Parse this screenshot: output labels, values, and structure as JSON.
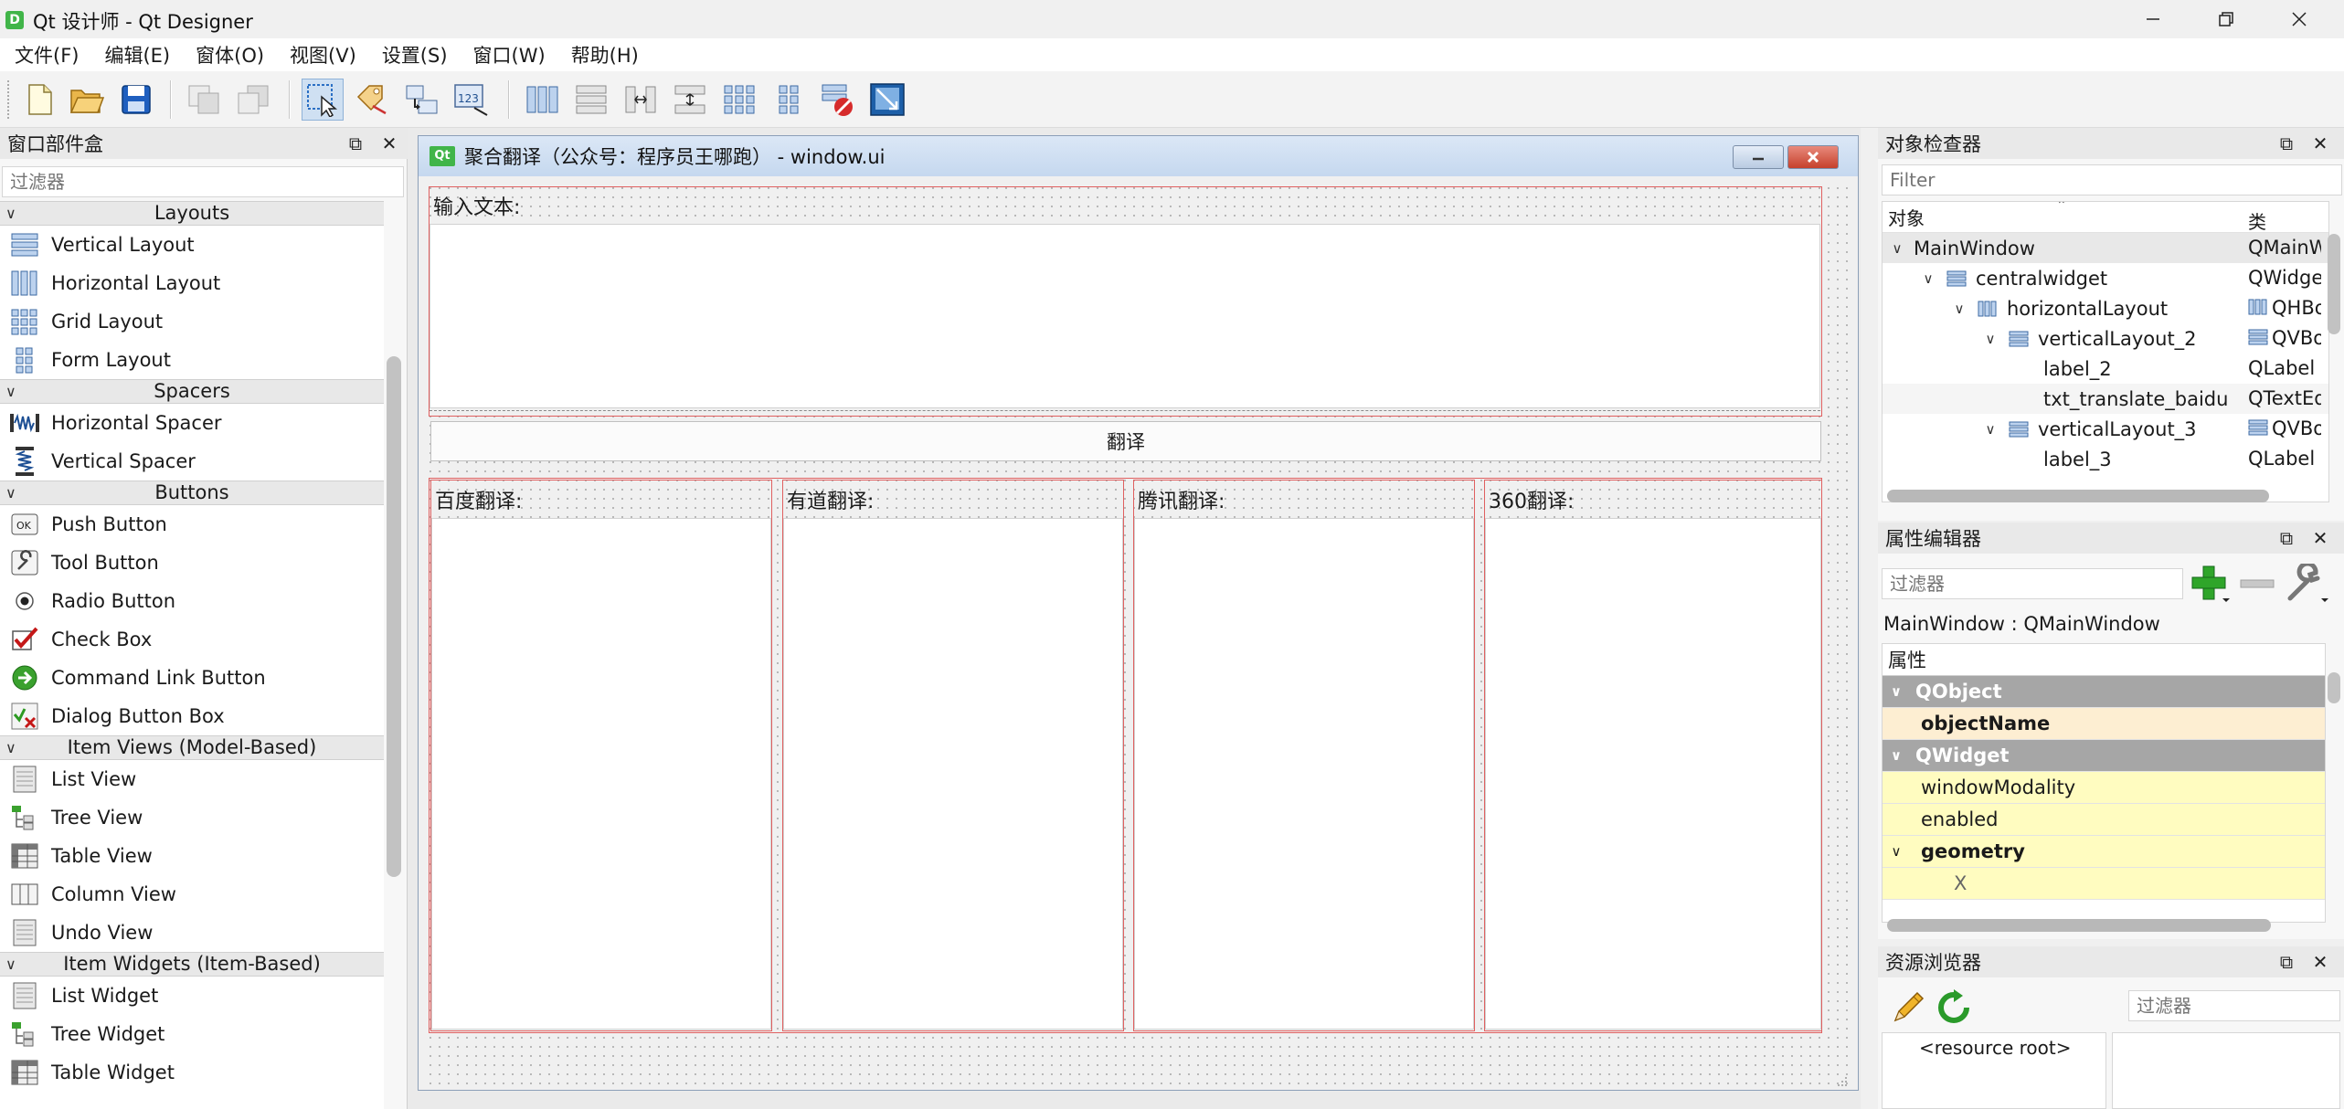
{
  "app": {
    "title": "Qt 设计师 - Qt Designer",
    "icon_letter": "D"
  },
  "menus": [
    "文件(F)",
    "编辑(E)",
    "窗体(O)",
    "视图(V)",
    "设置(S)",
    "窗口(W)",
    "帮助(H)"
  ],
  "toolbar": {
    "buttons": [
      "new-file-icon",
      "open-folder-icon",
      "save-disk-icon",
      "send-to-back-icon",
      "bring-to-front-icon",
      "edit-widgets-icon",
      "edit-signals-slots-icon",
      "edit-buddies-icon",
      "edit-tab-order-icon",
      "layout-horizontal-icon",
      "layout-vertical-icon",
      "layout-h-splitter-icon",
      "layout-v-splitter-icon",
      "layout-grid-icon",
      "layout-form-icon",
      "break-layout-icon",
      "adjust-size-icon"
    ]
  },
  "widget_box": {
    "title": "窗口部件盒",
    "filter_placeholder": "过滤器",
    "categories": [
      {
        "name": "Layouts",
        "items": [
          "Vertical Layout",
          "Horizontal Layout",
          "Grid Layout",
          "Form Layout"
        ]
      },
      {
        "name": "Spacers",
        "items": [
          "Horizontal Spacer",
          "Vertical Spacer"
        ]
      },
      {
        "name": "Buttons",
        "items": [
          "Push Button",
          "Tool Button",
          "Radio Button",
          "Check Box",
          "Command Link Button",
          "Dialog Button Box"
        ]
      },
      {
        "name": "Item Views (Model-Based)",
        "items": [
          "List View",
          "Tree View",
          "Table View",
          "Column View",
          "Undo View"
        ]
      },
      {
        "name": "Item Widgets (Item-Based)",
        "items": [
          "List Widget",
          "Tree Widget",
          "Table Widget"
        ]
      }
    ]
  },
  "form_window": {
    "title": "聚合翻译（公众号：程序员王哪跑） - window.ui",
    "icon_text": "Qt",
    "input_label": "输入文本:",
    "translate_button": "翻译",
    "result_labels": [
      "百度翻译:",
      "有道翻译:",
      "腾讯翻译:",
      "360翻译:"
    ]
  },
  "object_inspector": {
    "title": "对象检查器",
    "filter_placeholder": "Filter",
    "col_object": "对象",
    "col_class": "类",
    "rows": [
      {
        "name": "MainWindow",
        "class": "QMainWindow",
        "depth": 0,
        "expanded": true,
        "icon": "none",
        "selected": true
      },
      {
        "name": "centralwidget",
        "class": "QWidget",
        "depth": 1,
        "expanded": true,
        "icon": "vertical-layout-icon"
      },
      {
        "name": "horizontalLayout",
        "class": "QHBoxLayout",
        "depth": 2,
        "expanded": true,
        "icon": "horizontal-layout-icon"
      },
      {
        "name": "verticalLayout_2",
        "class": "QVBoxLayout",
        "depth": 3,
        "expanded": true,
        "icon": "vertical-layout-icon"
      },
      {
        "name": "label_2",
        "class": "QLabel",
        "depth": 4,
        "icon": "none"
      },
      {
        "name": "txt_translate_baidu",
        "class": "QTextEdit",
        "depth": 4,
        "icon": "none"
      },
      {
        "name": "verticalLayout_3",
        "class": "QVBoxLayout",
        "depth": 3,
        "expanded": true,
        "icon": "vertical-layout-icon"
      },
      {
        "name": "label_3",
        "class": "QLabel",
        "depth": 4,
        "icon": "none"
      }
    ]
  },
  "property_editor": {
    "title": "属性编辑器",
    "filter_placeholder": "过滤器",
    "object_label": "MainWindow : QMainWindow",
    "col_property": "属性",
    "rows": [
      {
        "label": "QObject",
        "kind": "group",
        "chevron": true
      },
      {
        "label": "objectName",
        "kind": "selected"
      },
      {
        "label": "QWidget",
        "kind": "group",
        "chevron": true
      },
      {
        "label": "windowModality",
        "kind": "yellow"
      },
      {
        "label": "enabled",
        "kind": "yellow"
      },
      {
        "label": "geometry",
        "kind": "yellow-bold",
        "chevron": true
      },
      {
        "label": "X",
        "kind": "yellow-sub"
      }
    ]
  },
  "resource_browser": {
    "title": "资源浏览器",
    "filter_placeholder": "过滤器",
    "root_label": "<resource root>"
  },
  "colors": {
    "form_red_outline": "#e06060",
    "property_group_gray": "#a6a6a6",
    "property_yellow": "#fffcc0",
    "qt_green": "#41b549"
  }
}
